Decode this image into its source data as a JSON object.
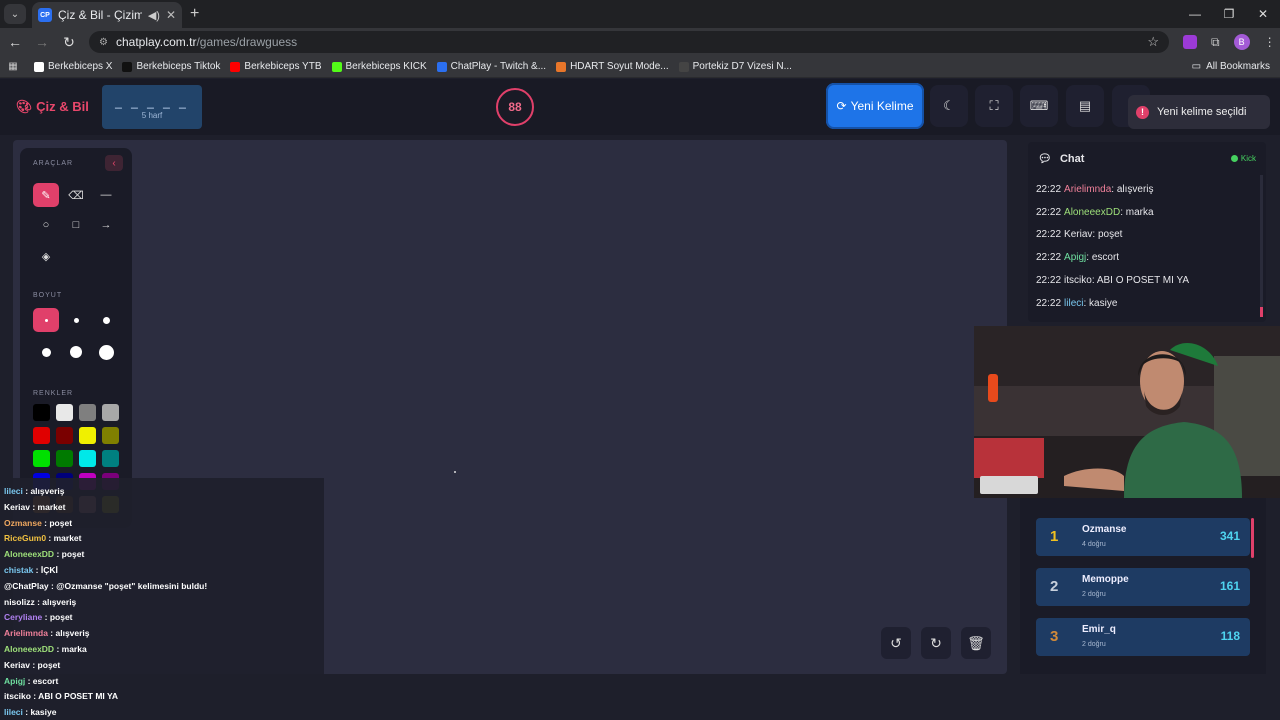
{
  "browser": {
    "tab_title": "Çiz & Bil - Çizim Oyunu",
    "tab_favicon": "CP",
    "url_host": "chatplay.com.tr",
    "url_path": "/games/drawguess",
    "profile_initial": "B",
    "bookmarks": [
      {
        "label": "Berkebiceps X",
        "color": "#ffffff"
      },
      {
        "label": "Berkebiceps Tiktok",
        "color": "#111111"
      },
      {
        "label": "Berkebiceps YTB",
        "color": "#ff0000"
      },
      {
        "label": "Berkebiceps KICK",
        "color": "#53fc18"
      },
      {
        "label": "ChatPlay - Twitch &...",
        "color": "#2b6ff0"
      },
      {
        "label": "HDART Soyut Mode...",
        "color": "#e8762a"
      },
      {
        "label": "Portekiz D7 Vizesi N...",
        "color": "#444444"
      }
    ],
    "all_bookmarks": "All Bookmarks"
  },
  "header": {
    "logo": "Çiz & Bil",
    "word_mask": "_ _ _ _ _",
    "word_length": "5 harf",
    "timer": "88",
    "new_word": "Yeni Kelime",
    "toast": "Yeni kelime seçildi"
  },
  "tools": {
    "section_tools": "ARAÇLAR",
    "section_size": "BOYUT",
    "section_colors": "RENKLER",
    "colors": [
      "#000000",
      "#e8e8e8",
      "#7f7f7f",
      "#a8a8a8",
      "#e00000",
      "#7a0000",
      "#f0f000",
      "#808000",
      "#00e000",
      "#007a00",
      "#00e8e8",
      "#008080",
      "#0000e0",
      "#00007a",
      "#c000c0",
      "#7a007a",
      "#d08020",
      "#7a4a10",
      "#c08080",
      "#b0b000"
    ]
  },
  "chat": {
    "title": "Chat",
    "platform": "Kick",
    "messages": [
      {
        "time": "22:22",
        "user": "Arielimnda",
        "color": "#f0809a",
        "text": ": alışveriş"
      },
      {
        "time": "22:22",
        "user": "AloneeexDD",
        "color": "#9ee07a",
        "text": ": marka"
      },
      {
        "time": "22:22",
        "user": "Keriav",
        "color": "#e6e6ea",
        "text": ": poşet"
      },
      {
        "time": "22:22",
        "user": "Apigj",
        "color": "#6fe0a0",
        "text": ": escort"
      },
      {
        "time": "22:22",
        "user": "itsciko",
        "color": "#e6e6ea",
        "text": ": ABI O POSET MI YA"
      },
      {
        "time": "22:22",
        "user": "lileci",
        "color": "#7ac8f0",
        "text": ": kasiye"
      }
    ]
  },
  "leaderboard": [
    {
      "rank": "1",
      "rank_color": "#f0c020",
      "name": "Ozmanse",
      "count": "4 doğru",
      "score": "341"
    },
    {
      "rank": "2",
      "rank_color": "#c8d0dc",
      "name": "Memoppe",
      "count": "2 doğru",
      "score": "161"
    },
    {
      "rank": "3",
      "rank_color": "#d08a3a",
      "name": "Emir_q",
      "count": "2 doğru",
      "score": "118"
    }
  ],
  "stream_chat": [
    {
      "user": "lileci",
      "color": "#7ac8f0",
      "text": " : alışveriş"
    },
    {
      "user": "Keriav",
      "color": "#ffffff",
      "text": " : market"
    },
    {
      "user": "Ozmanse",
      "color": "#f0a860",
      "text": " : poşet"
    },
    {
      "user": "RiceGum0",
      "color": "#f0c040",
      "text": " : market"
    },
    {
      "user": "AloneeexDD",
      "color": "#9ee07a",
      "text": " : poşet"
    },
    {
      "user": "chistak",
      "color": "#7ac8f0",
      "text": " : İÇKİ"
    },
    {
      "user": "@ChatPlay",
      "color": "#ffffff",
      "text": " : @Ozmanse \"poşet\" kelimesini buldu!"
    },
    {
      "user": "nisolizz",
      "color": "#ffffff",
      "text": " : alışveriş"
    },
    {
      "user": "Ceryliane",
      "color": "#b080f0",
      "text": " : poşet"
    },
    {
      "user": "Arielimnda",
      "color": "#f0809a",
      "text": " : alışveriş"
    },
    {
      "user": "AloneeexDD",
      "color": "#9ee07a",
      "text": " : marka"
    },
    {
      "user": "Keriav",
      "color": "#ffffff",
      "text": " : poşet"
    },
    {
      "user": "Apigj",
      "color": "#6fe0a0",
      "text": " : escort"
    },
    {
      "user": "itsciko",
      "color": "#ffffff",
      "text": " : ABI O POSET MI YA"
    },
    {
      "user": "lileci",
      "color": "#7ac8f0",
      "text": " : kasiye"
    }
  ]
}
